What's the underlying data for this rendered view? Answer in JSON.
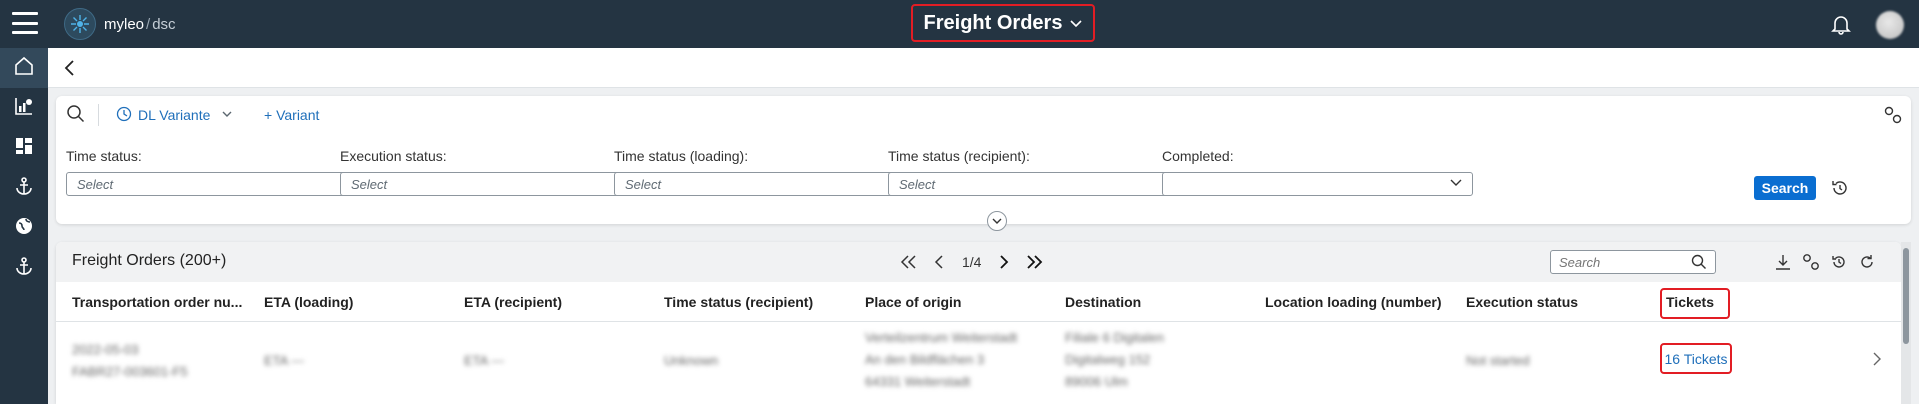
{
  "app": {
    "brand_name": "myleo",
    "brand_sub": "dsc",
    "title": "Freight Orders"
  },
  "rail": {
    "items": [
      {
        "name": "home-icon",
        "active": true
      },
      {
        "name": "analytics-icon",
        "active": false
      },
      {
        "name": "dashboard-icon",
        "active": false
      },
      {
        "name": "anchor-icon",
        "active": false
      },
      {
        "name": "globe-icon",
        "active": false
      },
      {
        "name": "anchor-icon-2",
        "active": false
      }
    ]
  },
  "filters": {
    "variant_label": "DL Variante",
    "add_variant_label": "+ Variant",
    "fields": [
      {
        "label": "Time status:",
        "placeholder": "Select"
      },
      {
        "label": "Execution status:",
        "placeholder": "Select"
      },
      {
        "label": "Time status (loading):",
        "placeholder": "Select"
      },
      {
        "label": "Time status (recipient):",
        "placeholder": "Select"
      },
      {
        "label": "Completed:",
        "placeholder": ""
      }
    ],
    "search_button": "Search"
  },
  "table": {
    "title": "Freight Orders (200+)",
    "page_info": "1/4",
    "search_placeholder": "Search",
    "columns": [
      "Transportation order nu...",
      "ETA (loading)",
      "ETA (recipient)",
      "Time status (recipient)",
      "Place of origin",
      "Destination",
      "Location loading (number)",
      "Execution status",
      "Tickets"
    ],
    "rows": [
      {
        "order": [
          "2022-05-03",
          "FABR27-003601-F5"
        ],
        "eta_loading": "ETA ---",
        "eta_recipient": "ETA ---",
        "time_status": "Unknown",
        "origin": [
          "Verteilzentrum Weiterstadt",
          "An den Bildflächen 3",
          "64331 Weiterstadt"
        ],
        "destination": [
          "Filiale 6 Digitalen",
          "Digitalweg 152",
          "89006 Ulm"
        ],
        "location_loading": "",
        "execution_status": "Not started",
        "tickets": "16 Tickets"
      }
    ]
  },
  "colors": {
    "topbar": "#243442",
    "accent": "#0a6ed1",
    "link": "#1f6fba",
    "highlight": "#e21d24"
  }
}
